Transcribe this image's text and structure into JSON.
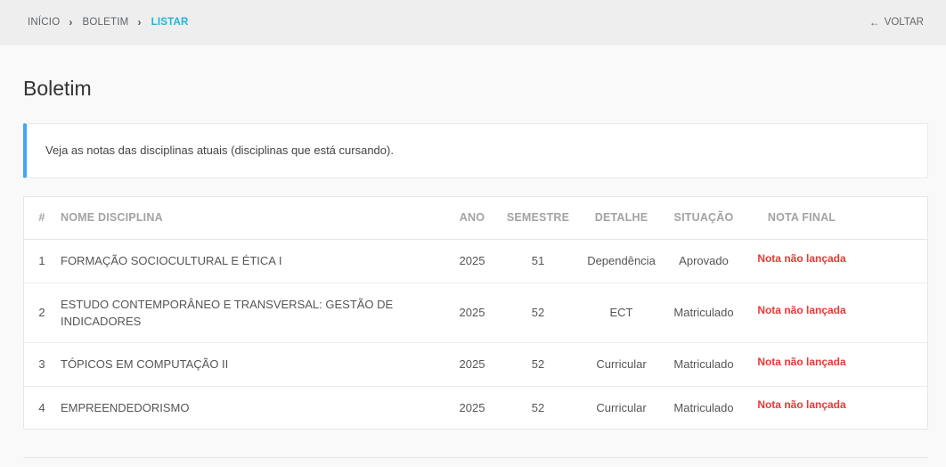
{
  "breadcrumb": {
    "items": [
      "INÍCIO",
      "BOLETIM",
      "LISTAR"
    ]
  },
  "back_button": {
    "label": "VOLTAR"
  },
  "page": {
    "title": "Boletim"
  },
  "info": {
    "message": "Veja as notas das disciplinas atuais (disciplinas que está cursando)."
  },
  "table": {
    "headers": [
      "#",
      "NOME DISCIPLINA",
      "ANO",
      "SEMESTRE",
      "DETALHE",
      "SITUAÇÃO",
      "NOTA FINAL"
    ],
    "rows": [
      {
        "num": "1",
        "name": "FORMAÇÃO SOCIOCULTURAL E ÉTICA I",
        "ano": "2025",
        "semestre": "51",
        "detalhe": "Dependência",
        "situacao": "Aprovado",
        "nota": "Nota não lançada"
      },
      {
        "num": "2",
        "name": "ESTUDO CONTEMPORÂNEO E TRANSVERSAL: GESTÃO DE INDICADORES",
        "ano": "2025",
        "semestre": "52",
        "detalhe": "ECT",
        "situacao": "Matriculado",
        "nota": "Nota não lançada"
      },
      {
        "num": "3",
        "name": "TÓPICOS EM COMPUTAÇÃO II",
        "ano": "2025",
        "semestre": "52",
        "detalhe": "Curricular",
        "situacao": "Matriculado",
        "nota": "Nota não lançada"
      },
      {
        "num": "4",
        "name": "EMPREENDEDORISMO",
        "ano": "2025",
        "semestre": "52",
        "detalhe": "Curricular",
        "situacao": "Matriculado",
        "nota": "Nota não lançada"
      }
    ]
  },
  "colors": {
    "accent": "#1fb6d8",
    "info_border": "#42a5f5",
    "nota_red": "#e53935"
  },
  "icons": {
    "separator": "chevron-right-icon",
    "back": "arrow-left-icon"
  }
}
